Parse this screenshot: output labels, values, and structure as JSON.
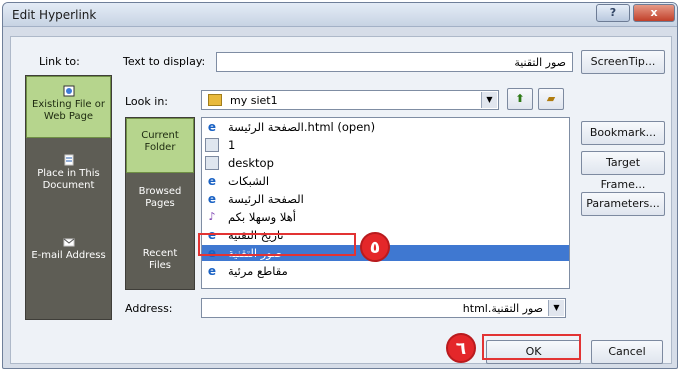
{
  "window": {
    "title": "Edit Hyperlink",
    "help_label": "?",
    "close_label": "x"
  },
  "link_to": {
    "label": "Link to:",
    "items": [
      {
        "label_line1": "Existing File or",
        "label_line2": "Web Page"
      },
      {
        "label_line1": "Place in This",
        "label_line2": "Document"
      },
      {
        "label_line1": "E-mail Address"
      }
    ]
  },
  "text_to_display": {
    "label": "Text to display:",
    "value": "صور التقنية"
  },
  "screentip_label": "ScreenTip...",
  "look_in": {
    "label": "Look in:",
    "value": "my siet1"
  },
  "places": [
    {
      "line1": "Current",
      "line2": "Folder"
    },
    {
      "line1": "Browsed",
      "line2": "Pages"
    },
    {
      "line1": "Recent",
      "line2": "Files"
    }
  ],
  "files": [
    {
      "name": "الصفحة الرئيسة.html (open)",
      "icon": "ie-icon"
    },
    {
      "name": "1",
      "icon": "page-icon"
    },
    {
      "name": "desktop",
      "icon": "page-icon"
    },
    {
      "name": "الشبكات",
      "icon": "ie-icon"
    },
    {
      "name": "الصفحة الرئيسة",
      "icon": "ie-icon"
    },
    {
      "name": "أهلا وسهلا بكم",
      "icon": "audio-icon"
    },
    {
      "name": "تاريخ التقنية",
      "icon": "ie-icon"
    },
    {
      "name": "صور التقنية",
      "icon": "ie-icon",
      "selected": true
    },
    {
      "name": "مقاطع مرئية",
      "icon": "ie-icon"
    }
  ],
  "buttons": {
    "bookmark": "Bookmark...",
    "target_frame": "Target Frame...",
    "parameters": "Parameters...",
    "ok": "OK",
    "cancel": "Cancel"
  },
  "address": {
    "label": "Address:",
    "value": "صور التقنية.html"
  },
  "callouts": {
    "step5": "٥",
    "step6": "٦"
  },
  "colors": {
    "selected_pane": "#b6d58d",
    "pane_bg": "#5e5d55",
    "selection": "#3f78d1",
    "callout": "#e4272a"
  }
}
